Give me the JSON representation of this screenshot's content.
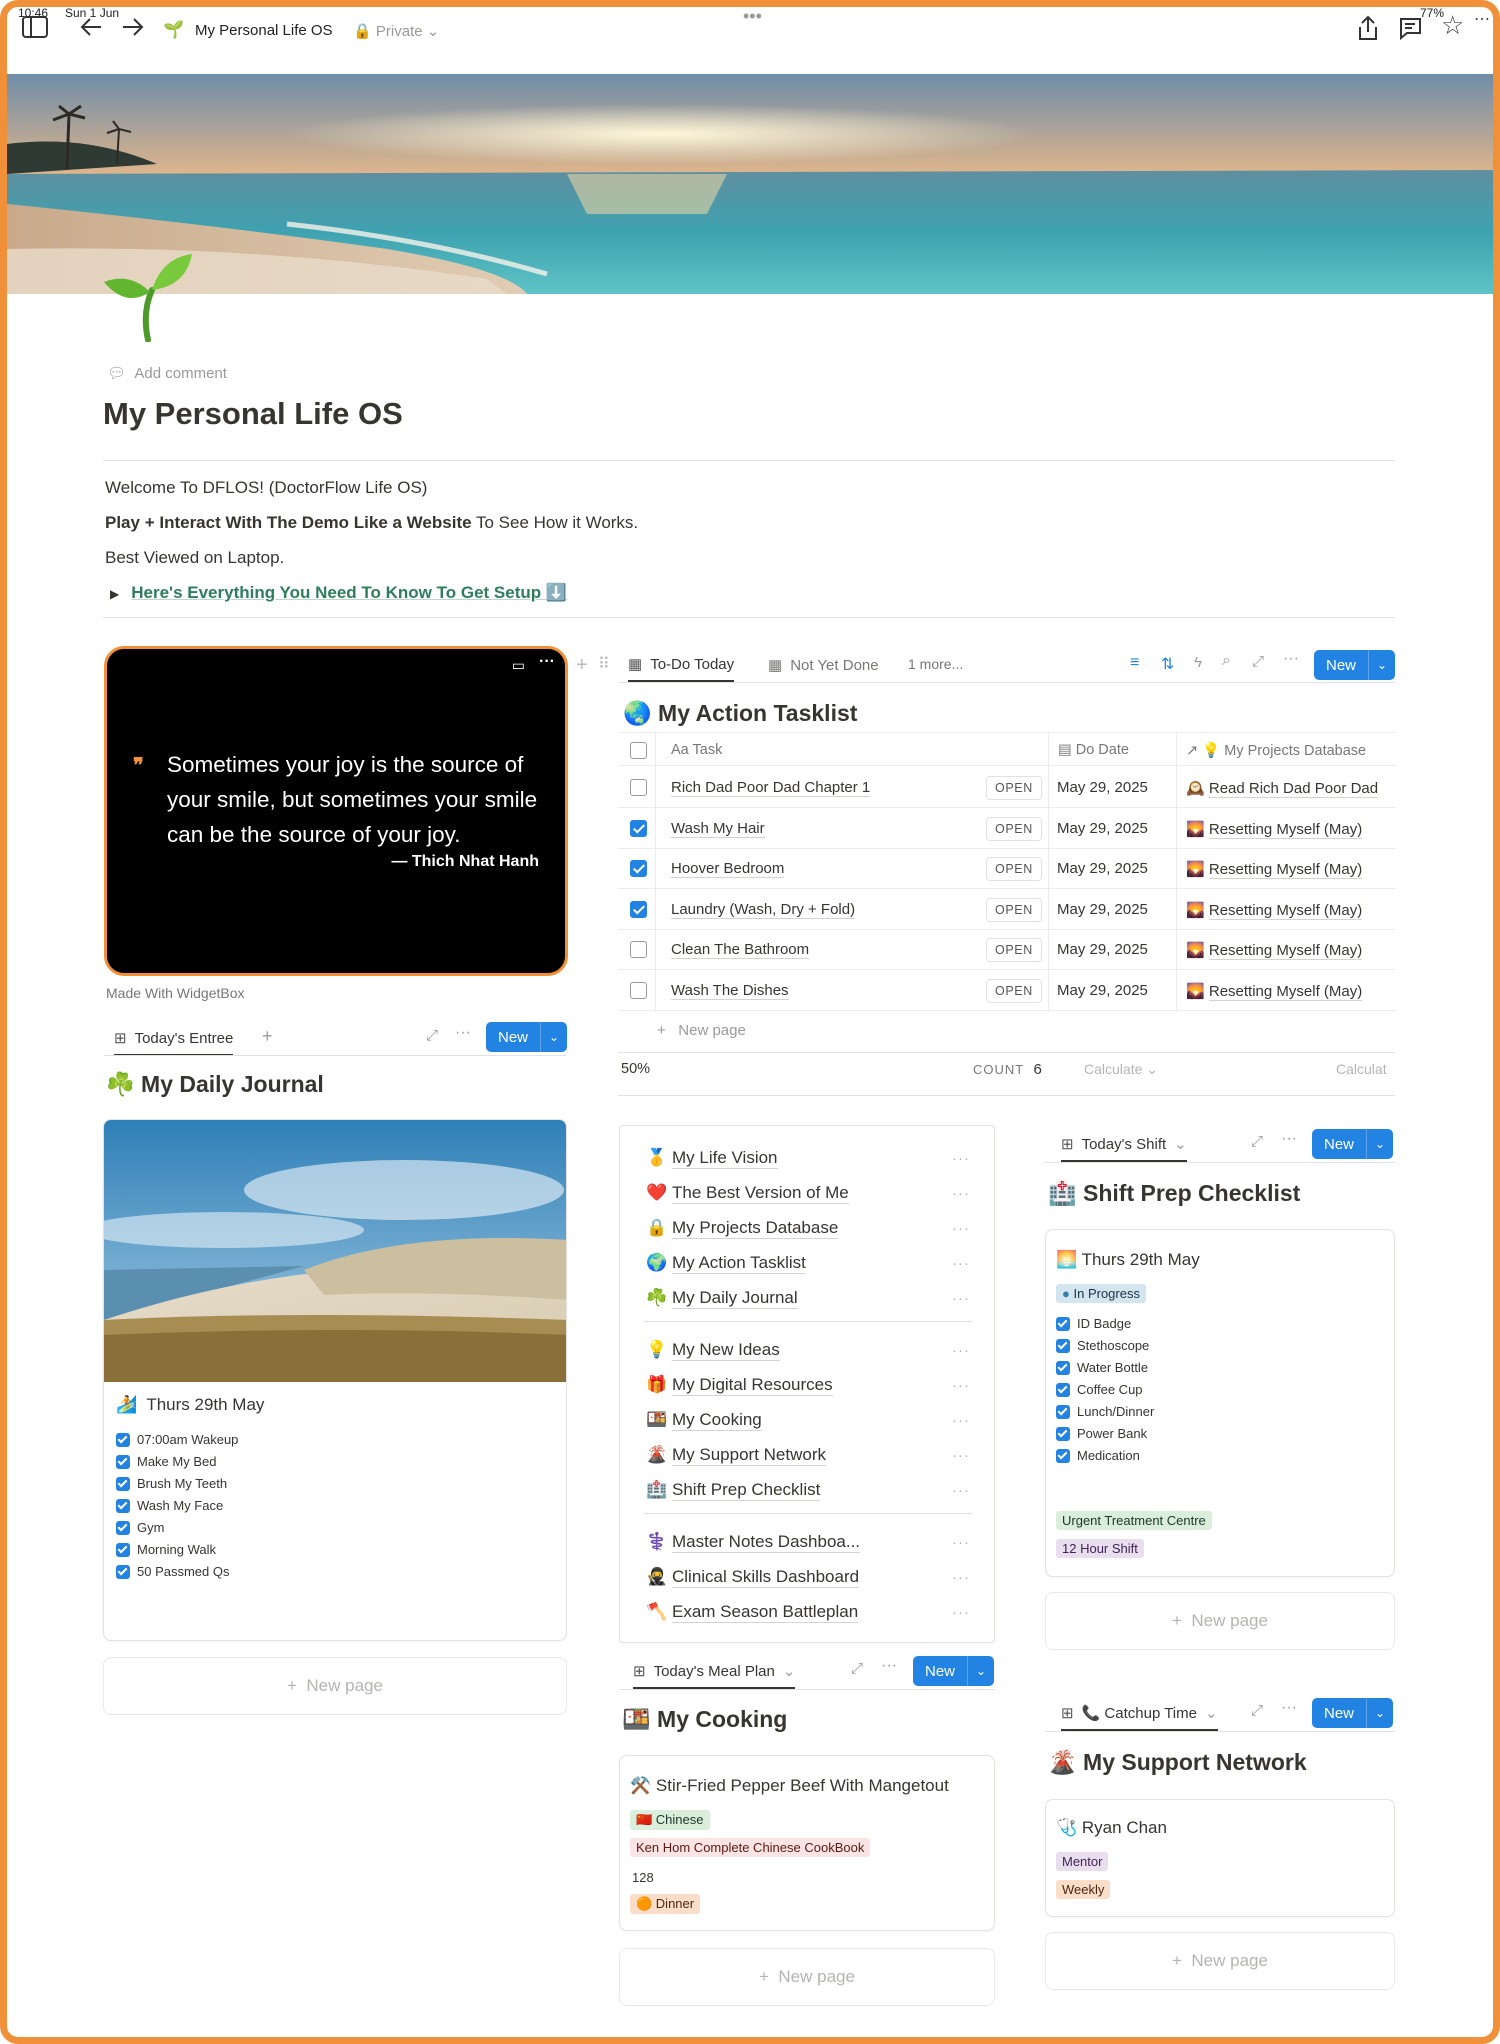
{
  "status": {
    "time": "10:46",
    "date": "Sun 1 Jun",
    "battery": "77%"
  },
  "breadcrumb": {
    "icon": "🌱",
    "title": "My Personal Life OS",
    "privacy": "Private"
  },
  "page": {
    "add_comment": "Add comment",
    "title": "My Personal Life OS",
    "welcome": "Welcome To DFLOS! (DoctorFlow Life OS)",
    "play_bold": "Play + Interact With The Demo Like a Website",
    "play_rest": " To See How it Works.",
    "best_viewed": "Best Viewed on Laptop.",
    "setup_toggle": "Here's Everything You Need To Know To Get Setup ⬇️"
  },
  "quote_widget": {
    "text": "Sometimes your joy is the source of your smile, but sometimes your smile can be the source of your joy.",
    "author": "— Thich Nhat Hanh",
    "caption": "Made With WidgetBox"
  },
  "tasklist": {
    "tabs": [
      "To-Do Today",
      "Not Yet Done",
      "1 more..."
    ],
    "new_label": "New",
    "title_icon": "🌏",
    "title": "My Action Tasklist",
    "headers": {
      "task": "Aa Task",
      "date": "Do Date",
      "project": "💡 My Projects Database"
    },
    "open_label": "OPEN",
    "rows": [
      {
        "task": "Rich Dad Poor Dad Chapter 1",
        "done": false,
        "date": "May 29, 2025",
        "project_icon": "🕰️",
        "project": "Read Rich Dad Poor Dad"
      },
      {
        "task": "Wash My Hair",
        "done": true,
        "date": "May 29, 2025",
        "project_icon": "🌄",
        "project": "Resetting Myself (May)"
      },
      {
        "task": "Hoover Bedroom",
        "done": true,
        "date": "May 29, 2025",
        "project_icon": "🌄",
        "project": "Resetting Myself (May)"
      },
      {
        "task": "Laundry (Wash, Dry + Fold)",
        "done": true,
        "date": "May 29, 2025",
        "project_icon": "🌄",
        "project": "Resetting Myself (May)"
      },
      {
        "task": "Clean The Bathroom",
        "done": false,
        "date": "May 29, 2025",
        "project_icon": "🌄",
        "project": "Resetting Myself (May)"
      },
      {
        "task": "Wash The Dishes",
        "done": false,
        "date": "May 29, 2025",
        "project_icon": "🌄",
        "project": "Resetting Myself (May)"
      }
    ],
    "new_page": "New page",
    "footer": {
      "percent": "50%",
      "count_label": "COUNT",
      "count": "6",
      "calculate": "Calculate",
      "calculate2": "Calculat"
    }
  },
  "journal": {
    "view": "Today's Entree",
    "new_label": "New",
    "title_icon": "☘️",
    "title": "My Daily Journal",
    "entry_icon": "🏄",
    "entry_title": "Thurs 29th May",
    "items": [
      "07:00am Wakeup",
      "Make My Bed",
      "Brush My Teeth",
      "Wash My Face",
      "Gym",
      "Morning Walk",
      "50 Passmed Qs"
    ],
    "new_page": "New page"
  },
  "nav": {
    "groups": [
      [
        {
          "icon": "🥇",
          "label": "My Life Vision"
        },
        {
          "icon": "❤️",
          "label": "The Best Version of Me"
        },
        {
          "icon": "🔒",
          "label": "My Projects Database"
        },
        {
          "icon": "🌍",
          "label": "My Action Tasklist"
        },
        {
          "icon": "☘️",
          "label": "My Daily Journal"
        }
      ],
      [
        {
          "icon": "💡",
          "label": "My New Ideas"
        },
        {
          "icon": "🎁",
          "label": "My Digital Resources"
        },
        {
          "icon": "🍱",
          "label": "My Cooking"
        },
        {
          "icon": "🌋",
          "label": "My Support Network"
        },
        {
          "icon": "🏥",
          "label": "Shift Prep Checklist"
        }
      ],
      [
        {
          "icon": "⚕️",
          "label": "Master Notes Dashboa..."
        },
        {
          "icon": "🥷",
          "label": "Clinical Skills Dashboard"
        },
        {
          "icon": "🪓",
          "label": "Exam Season Battleplan"
        }
      ]
    ]
  },
  "cooking": {
    "view": "Today's Meal Plan",
    "new_label": "New",
    "title_icon": "🍱",
    "title": "My Cooking",
    "card_icon": "⚒️",
    "card_title": "Stir-Fried Pepper Beef With Mangetout",
    "cuisine": "🇨🇳 Chinese",
    "book": "Ken Hom Complete Chinese CookBook",
    "page": "128",
    "meal": "🟠 Dinner",
    "new_page": "New page"
  },
  "shift": {
    "view": "Today's Shift",
    "new_label": "New",
    "title_icon": "🏥",
    "title": "Shift Prep Checklist",
    "card_icon": "🌅",
    "card_title": "Thurs 29th May",
    "status": "In Progress",
    "items": [
      "ID Badge",
      "Stethoscope",
      "Water Bottle",
      "Coffee Cup",
      "Lunch/Dinner",
      "Power Bank",
      "Medication"
    ],
    "location": "Urgent Treatment Centre",
    "length": "12 Hour Shift",
    "new_page": "New page"
  },
  "support": {
    "view": "📞 Catchup Time",
    "new_label": "New",
    "title_icon": "🌋",
    "title": "My Support Network",
    "card_icon": "🩺",
    "card_title": "Ryan Chan",
    "role": "Mentor",
    "frequency": "Weekly",
    "new_page": "New page"
  },
  "colors": {
    "accent": "#2383e2",
    "frame": "#f0913a",
    "link_green": "#2e7d5b"
  }
}
